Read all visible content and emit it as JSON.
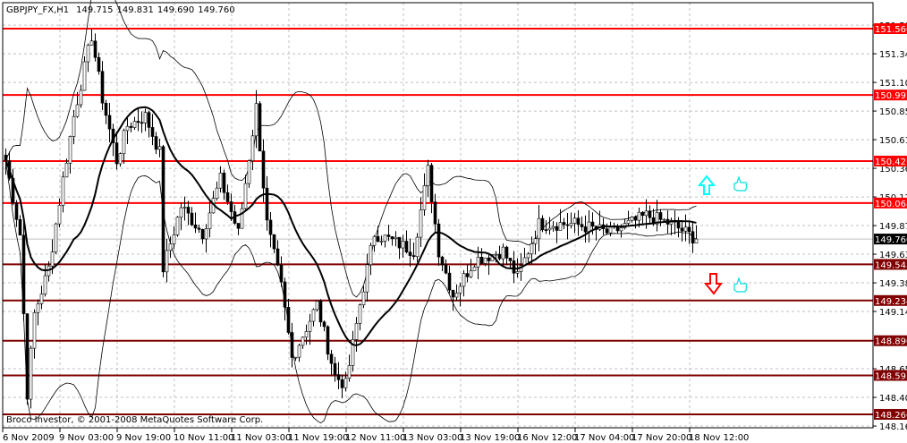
{
  "header": {
    "symbol": "GBPJPY_FX,H1",
    "open": "149.715",
    "high": "149.831",
    "low": "149.690",
    "close": "149.760"
  },
  "footer": {
    "copyright": "Broco Investor, © 2001-2008 MetaQuotes Software Corp."
  },
  "current_price": {
    "label": "149.760",
    "value": 149.76
  },
  "price_axis": {
    "range": [
      148.16,
      151.6
    ],
    "ticks": [
      "151.590",
      "151.345",
      "151.100",
      "150.855",
      "150.610",
      "150.365",
      "150.120",
      "149.875",
      "149.630",
      "149.385",
      "149.140",
      "148.890",
      "148.650",
      "148.405",
      "148.160"
    ]
  },
  "time_axis": {
    "labels": [
      "6 Nov 2009",
      "9 Nov 03:00",
      "9 Nov 19:00",
      "10 Nov 11:00",
      "11 Nov 03:00",
      "11 Nov 19:00",
      "12 Nov 11:00",
      "13 Nov 03:00",
      "13 Nov 19:00",
      "16 Nov 12:00",
      "17 Nov 04:00",
      "17 Nov 20:00",
      "18 Nov 12:00"
    ],
    "bars_per_label": 16
  },
  "levels": [
    {
      "label": "151.560",
      "value": 151.56,
      "color": "#ff0000"
    },
    {
      "label": "150.992",
      "value": 150.992,
      "color": "#ff0000"
    },
    {
      "label": "150.427",
      "value": 150.427,
      "color": "#ff0000"
    },
    {
      "label": "150.068",
      "value": 150.068,
      "color": "#ff0000"
    },
    {
      "label": "149.543",
      "value": 149.543,
      "color": "#800000"
    },
    {
      "label": "149.234",
      "value": 149.234,
      "color": "#800000"
    },
    {
      "label": "148.890",
      "value": 148.89,
      "color": "#800000"
    },
    {
      "label": "148.593",
      "value": 148.593,
      "color": "#800000"
    },
    {
      "label": "148.260",
      "value": 148.26,
      "color": "#800000"
    }
  ],
  "signals": [
    {
      "type": "arrow-up",
      "color": "#00ffff"
    },
    {
      "type": "arrow-down",
      "color": "#ff0000"
    },
    {
      "type": "thumbs-up",
      "color": "#00ffff"
    },
    {
      "type": "thumbs-up",
      "color": "#00ffff"
    }
  ],
  "chart_data": {
    "type": "candlestick",
    "price_path": [
      [
        0,
        150.43
      ],
      [
        4,
        149.8
      ],
      [
        6,
        148.44
      ],
      [
        8,
        149.12
      ],
      [
        12,
        149.51
      ],
      [
        16,
        150.27
      ],
      [
        19,
        150.81
      ],
      [
        24,
        151.5
      ],
      [
        27,
        150.96
      ],
      [
        31,
        150.43
      ],
      [
        34,
        150.73
      ],
      [
        39,
        150.81
      ],
      [
        43,
        150.5
      ],
      [
        44,
        149.51
      ],
      [
        49,
        150.04
      ],
      [
        55,
        149.81
      ],
      [
        60,
        150.27
      ],
      [
        65,
        149.81
      ],
      [
        70,
        150.89
      ],
      [
        73,
        149.89
      ],
      [
        77,
        149.35
      ],
      [
        80,
        148.74
      ],
      [
        87,
        149.2
      ],
      [
        92,
        148.59
      ],
      [
        95,
        148.51
      ],
      [
        99,
        149.2
      ],
      [
        103,
        149.81
      ],
      [
        109,
        149.73
      ],
      [
        114,
        149.66
      ],
      [
        118,
        150.35
      ],
      [
        121,
        149.66
      ],
      [
        125,
        149.28
      ],
      [
        131,
        149.58
      ],
      [
        139,
        149.66
      ],
      [
        143,
        149.43
      ],
      [
        149,
        149.89
      ],
      [
        159,
        149.89
      ],
      [
        169,
        149.81
      ],
      [
        179,
        149.96
      ],
      [
        186,
        149.89
      ],
      [
        193,
        149.76
      ]
    ],
    "indicators": [
      "SMA 20",
      "Bollinger Bands 20, 2"
    ]
  }
}
